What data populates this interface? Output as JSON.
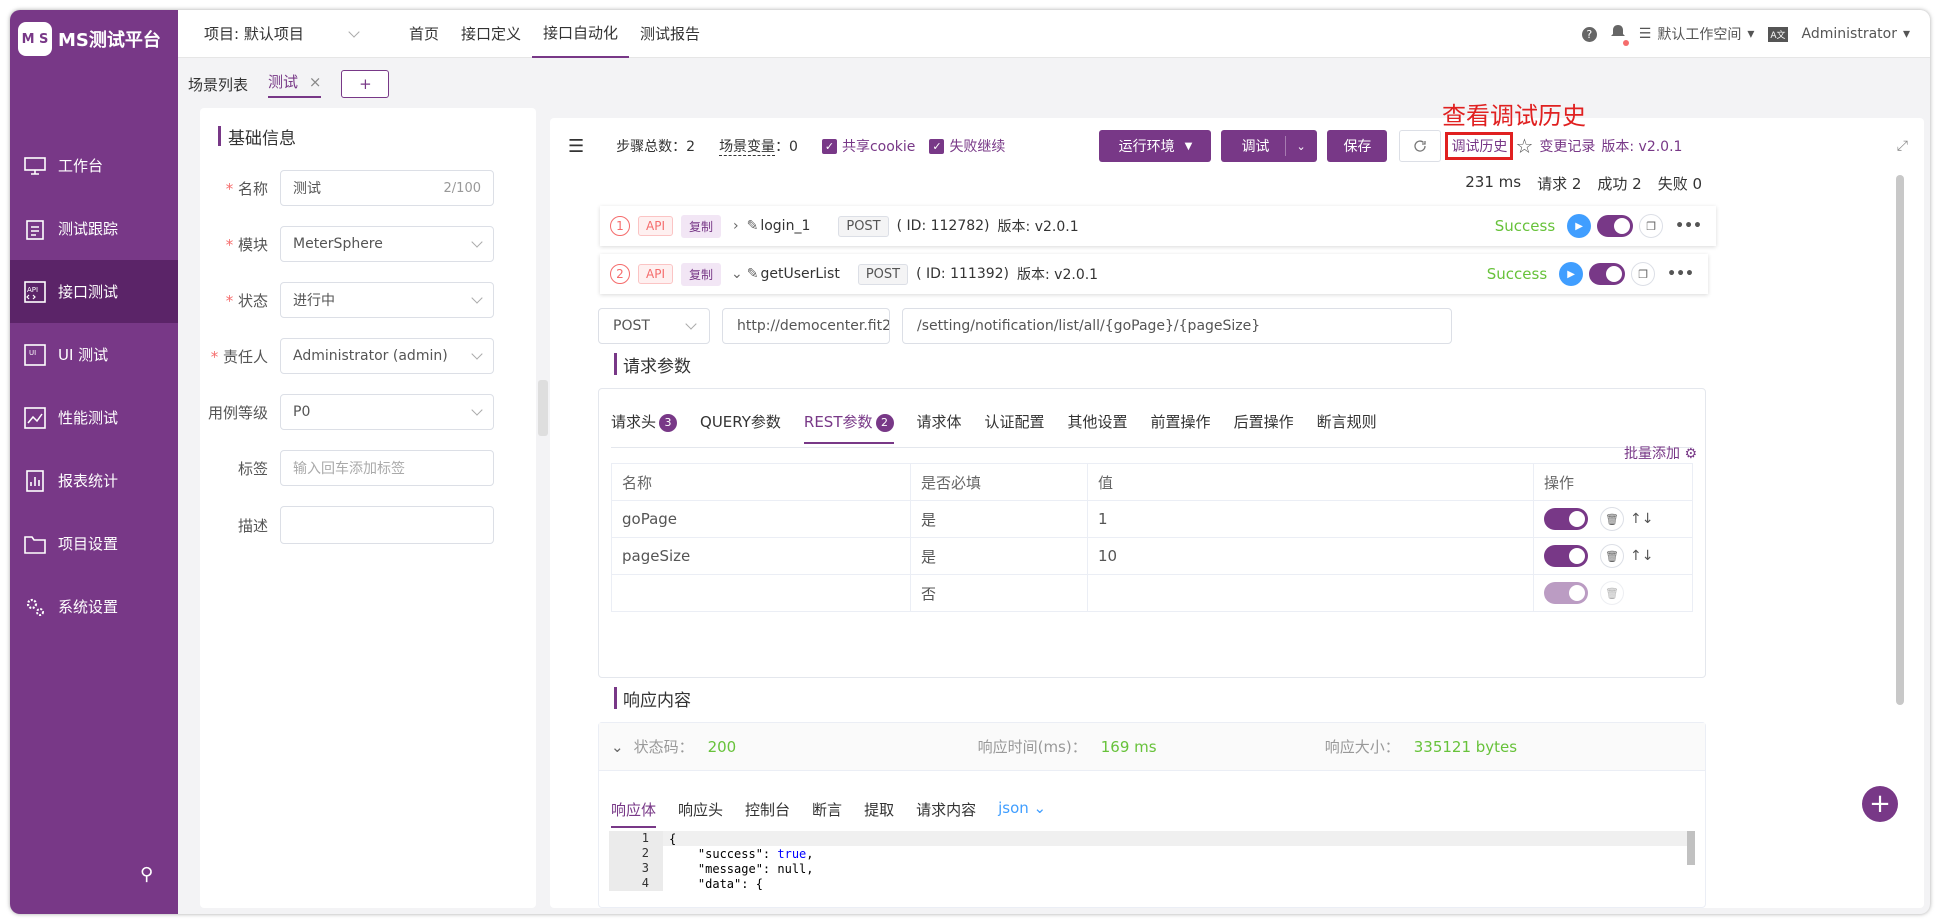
{
  "app": {
    "logo_text": "MS测试平台",
    "logo_mark": "M S"
  },
  "sidebar": {
    "items": [
      {
        "label": "工作台",
        "icon": "monitor-icon"
      },
      {
        "label": "测试跟踪",
        "icon": "clipboard-icon"
      },
      {
        "label": "接口测试",
        "icon": "api-icon",
        "active": true
      },
      {
        "label": "UI 测试",
        "icon": "ui-icon"
      },
      {
        "label": "性能测试",
        "icon": "chart-icon"
      },
      {
        "label": "报表统计",
        "icon": "report-icon"
      },
      {
        "label": "项目设置",
        "icon": "folder-icon"
      },
      {
        "label": "系统设置",
        "icon": "gear-icon"
      }
    ]
  },
  "topbar": {
    "project_label": "项目: 默认项目",
    "nav": [
      "首页",
      "接口定义",
      "接口自动化",
      "测试报告"
    ],
    "workspace": "默认工作空间",
    "user": "Administrator"
  },
  "tabs": {
    "scene_list": "场景列表",
    "current": "测试",
    "close": "×",
    "add": "+"
  },
  "form": {
    "title": "基础信息",
    "name_label": "名称",
    "name_value": "测试",
    "name_count": "2/100",
    "module_label": "模块",
    "module_value": "MeterSphere",
    "status_label": "状态",
    "status_value": "进行中",
    "owner_label": "责任人",
    "owner_value": "Administrator (admin)",
    "level_label": "用例等级",
    "level_value": "P0",
    "tag_label": "标签",
    "tag_placeholder": "输入回车添加标签",
    "desc_label": "描述"
  },
  "toolbar": {
    "steps": "步骤总数：2",
    "vars": "场景变量",
    "vars_count": "：0",
    "share_cookie": "共享cookie",
    "fail_continue": "失败继续",
    "env": "运行环境",
    "debug": "调试",
    "save": "保存",
    "history": "调试历史",
    "changes": "变更记录",
    "version": "版本: v2.0.1"
  },
  "annotation": "查看调试历史",
  "stats": {
    "time": "231 ms",
    "requests": "请求 2",
    "success": "成功 2",
    "fail": "失败 0"
  },
  "steps": [
    {
      "num": "1",
      "api": "API",
      "copy": "复制",
      "name": "login_1",
      "method": "POST",
      "id": "( ID: 112782)",
      "version": "版本: v2.0.1",
      "status": "Success"
    },
    {
      "num": "2",
      "api": "API",
      "copy": "复制",
      "name": "getUserList",
      "method": "POST",
      "id": "( ID: 111392)",
      "version": "版本: v2.0.1",
      "status": "Success"
    }
  ],
  "request": {
    "method": "POST",
    "host": "http://democenter.fit2",
    "path": "/setting/notification/list/all/{goPage}/{pageSize}",
    "title": "请求参数",
    "tabs": [
      "请求头",
      "QUERY参数",
      "REST参数",
      "请求体",
      "认证配置",
      "其他设置",
      "前置操作",
      "后置操作",
      "断言规则"
    ],
    "header_badge": "3",
    "rest_badge": "2",
    "bulk_add": "批量添加",
    "columns": [
      "名称",
      "是否必填",
      "值",
      "操作"
    ],
    "rows": [
      {
        "name": "goPage",
        "required": "是",
        "value": "1"
      },
      {
        "name": "pageSize",
        "required": "是",
        "value": "10"
      },
      {
        "name": "",
        "required": "否",
        "value": ""
      }
    ]
  },
  "response": {
    "title": "响应内容",
    "status_label": "状态码：",
    "status_value": "200",
    "time_label": "响应时间(ms)：",
    "time_value": "169 ms",
    "size_label": "响应大小：",
    "size_value": "335121 bytes",
    "tabs": [
      "响应体",
      "响应头",
      "控制台",
      "断言",
      "提取",
      "请求内容"
    ],
    "format": "json",
    "code": [
      {
        "n": "1",
        "text": "{"
      },
      {
        "n": "2",
        "text": "    \"success\": ",
        "kw": "true",
        "tail": ","
      },
      {
        "n": "3",
        "text": "    \"message\": null,"
      },
      {
        "n": "4",
        "text": "    \"data\": {"
      }
    ]
  },
  "colors": {
    "primary": "#783887",
    "success": "#67c23a",
    "danger": "#f56c6c",
    "annotation": "#e02020"
  }
}
